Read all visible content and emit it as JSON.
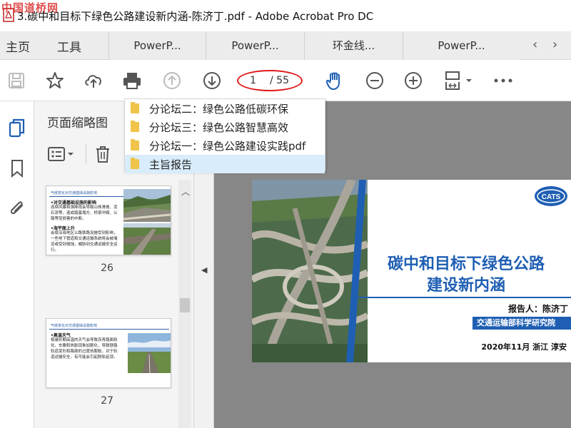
{
  "window": {
    "title": "3.碳中和目标下绿色公路建设新内涵-陈济丁.pdf - Adobe Acrobat Pro DC",
    "watermark": "中国道桥网"
  },
  "nav": {
    "home": "主页",
    "tools": "工具"
  },
  "tabs": [
    {
      "label": "PowerP..."
    },
    {
      "label": "PowerP..."
    },
    {
      "label": "环金线..."
    },
    {
      "label": "PowerP..."
    }
  ],
  "toolbar": {
    "current_page": "1",
    "total_pages": "/ 55",
    "icons": [
      "save-icon",
      "bookmark-star-icon",
      "cloud-upload-icon",
      "print-icon",
      "page-up-icon",
      "page-down-icon",
      "hand-tool-icon",
      "zoom-out-icon",
      "zoom-in-icon",
      "fit-page-icon",
      "more-icon"
    ]
  },
  "sidebar": {
    "panel_title": "页面缩略图",
    "icons": [
      "page-thumbnails-icon",
      "bookmark-icon",
      "attachment-icon"
    ]
  },
  "popup": {
    "items": [
      {
        "label": "分论坛二：绿色公路低碳环保"
      },
      {
        "label": "分论坛三：绿色公路智慧高效"
      },
      {
        "label": "分论坛一：绿色公路建设实践pdf"
      },
      {
        "label": "主旨报告",
        "selected": true
      }
    ]
  },
  "thumbnails": [
    {
      "page": "26",
      "header": "气候变化对交通基础设施影响",
      "heading1": "•对交通基础设施的影响",
      "body1": "连续风暴和强降雨会导致山体滑坡、泥石流等，造成路基塌方、桥梁冲毁、公路等受损害的中断。",
      "heading2": "•海平面上升",
      "body2": "会使沿海地区公路铁路设施受到影响，一些地下管道和交通运输系统将会被淹没或受到侵蚀，威胁到交通运输安全运行。"
    },
    {
      "page": "27",
      "header": "气候变化对交通基础设施影响",
      "heading1": "•高温天气",
      "body1": "极端长期高温的天气会导致沥青路面软化、车辙和热胀现象加剧化，导致铁路轨道变形和路面的过度热膨胀，对于轨道运输安全，有可能会引起脱轨延误。"
    }
  ],
  "slide": {
    "title_line1": "碳中和目标下绿色公路",
    "title_line2": "建设新内涵",
    "reporter": "报告人：陈济丁",
    "organization": "交通运输部科学研究院",
    "date_place": "2020年11月   浙江   淳安",
    "logo_text": "CATS"
  },
  "colors": {
    "accent_blue": "#1f5fb3",
    "highlight_oval": "#e01a1a",
    "folder_yellow": "#f0c44a",
    "selected_item": "#d8ecfb"
  }
}
